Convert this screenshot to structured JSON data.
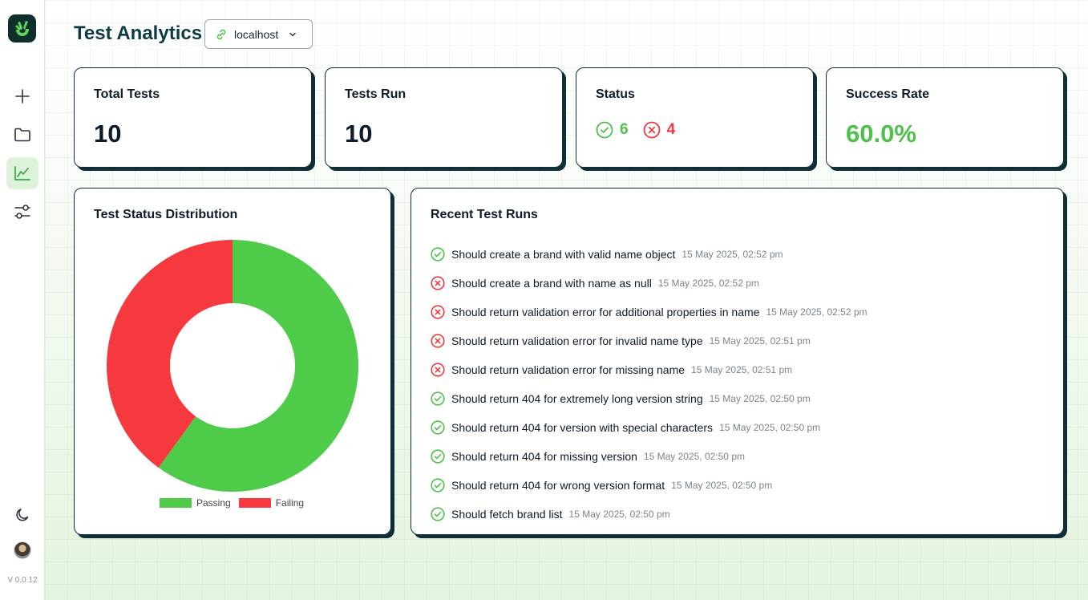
{
  "sidebar": {
    "version": "V 0.0.12",
    "items": [
      {
        "icon": "plus-icon"
      },
      {
        "icon": "folder-icon"
      },
      {
        "icon": "analytics-icon",
        "active": true
      },
      {
        "icon": "sliders-icon"
      }
    ],
    "theme_icon": "moon-icon"
  },
  "header": {
    "title": "Test Analytics",
    "environment": "localhost"
  },
  "stats": {
    "total_tests": {
      "label": "Total Tests",
      "value": "10"
    },
    "tests_run": {
      "label": "Tests Run",
      "value": "10"
    },
    "status": {
      "label": "Status",
      "passed": "6",
      "failed": "4"
    },
    "success_rate": {
      "label": "Success Rate",
      "value": "60.0%"
    }
  },
  "distribution": {
    "title": "Test Status Distribution"
  },
  "chart_data": {
    "type": "pie",
    "donut": true,
    "categories": [
      "Passing",
      "Failing"
    ],
    "values": [
      6,
      4
    ],
    "colors": [
      "#4fcb4a",
      "#f6383f"
    ],
    "legend": "bottom"
  },
  "recent": {
    "title": "Recent Test Runs",
    "runs": [
      {
        "status": "pass",
        "name": "Should create a brand with valid name object",
        "time": "15 May 2025, 02:52 pm"
      },
      {
        "status": "fail",
        "name": "Should create a brand with name as null",
        "time": "15 May 2025, 02:52 pm"
      },
      {
        "status": "fail",
        "name": "Should return validation error for additional properties in name",
        "time": "15 May 2025, 02:52 pm"
      },
      {
        "status": "fail",
        "name": "Should return validation error for invalid name type",
        "time": "15 May 2025, 02:51 pm"
      },
      {
        "status": "fail",
        "name": "Should return validation error for missing name",
        "time": "15 May 2025, 02:51 pm"
      },
      {
        "status": "pass",
        "name": "Should return 404 for extremely long version string",
        "time": "15 May 2025, 02:50 pm"
      },
      {
        "status": "pass",
        "name": "Should return 404 for version with special characters",
        "time": "15 May 2025, 02:50 pm"
      },
      {
        "status": "pass",
        "name": "Should return 404 for missing version",
        "time": "15 May 2025, 02:50 pm"
      },
      {
        "status": "pass",
        "name": "Should return 404 for wrong version format",
        "time": "15 May 2025, 02:50 pm"
      },
      {
        "status": "pass",
        "name": "Should fetch brand list",
        "time": "15 May 2025, 02:50 pm"
      }
    ]
  }
}
